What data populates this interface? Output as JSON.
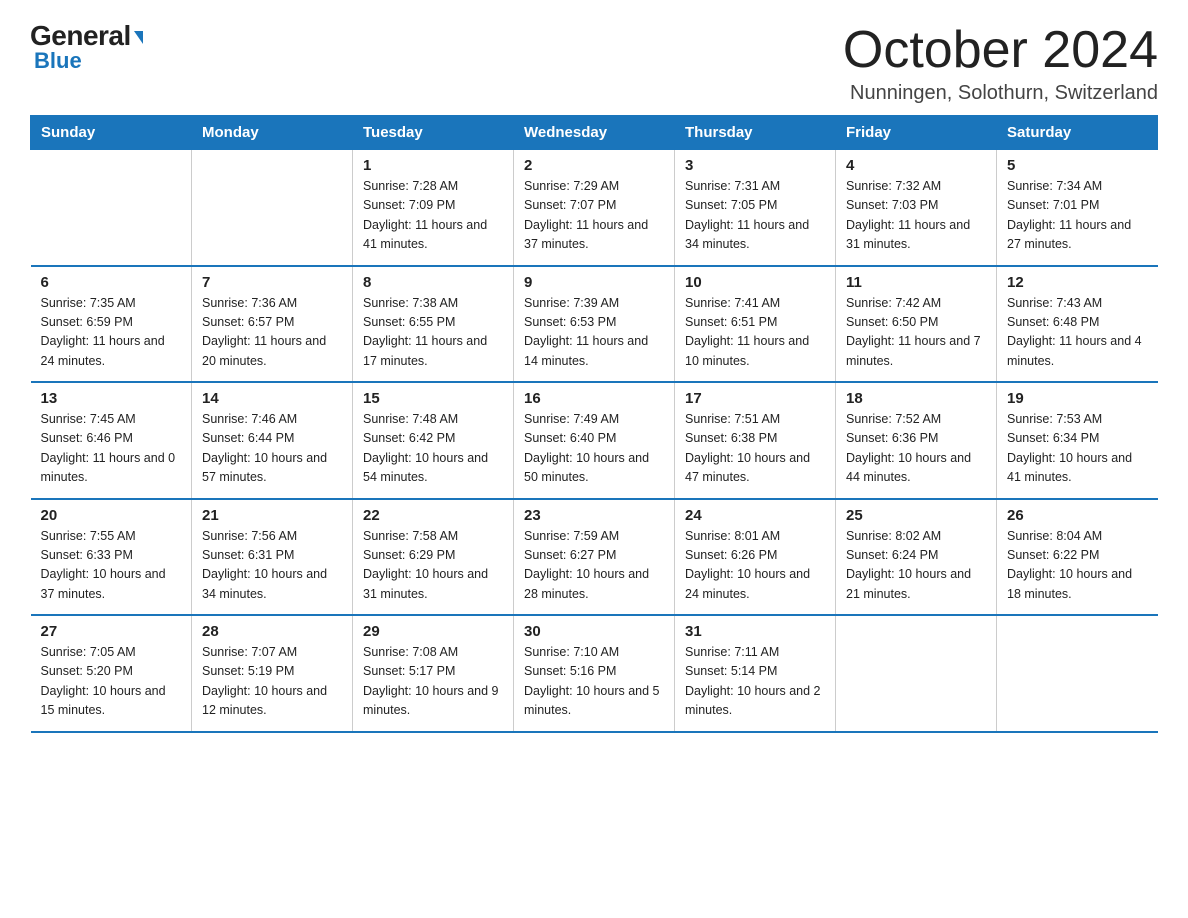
{
  "logo": {
    "general": "General",
    "triangle": "▶",
    "blue": "Blue"
  },
  "title": {
    "month_year": "October 2024",
    "location": "Nunningen, Solothurn, Switzerland"
  },
  "headers": [
    "Sunday",
    "Monday",
    "Tuesday",
    "Wednesday",
    "Thursday",
    "Friday",
    "Saturday"
  ],
  "weeks": [
    [
      {
        "day": "",
        "sunrise": "",
        "sunset": "",
        "daylight": ""
      },
      {
        "day": "",
        "sunrise": "",
        "sunset": "",
        "daylight": ""
      },
      {
        "day": "1",
        "sunrise": "Sunrise: 7:28 AM",
        "sunset": "Sunset: 7:09 PM",
        "daylight": "Daylight: 11 hours and 41 minutes."
      },
      {
        "day": "2",
        "sunrise": "Sunrise: 7:29 AM",
        "sunset": "Sunset: 7:07 PM",
        "daylight": "Daylight: 11 hours and 37 minutes."
      },
      {
        "day": "3",
        "sunrise": "Sunrise: 7:31 AM",
        "sunset": "Sunset: 7:05 PM",
        "daylight": "Daylight: 11 hours and 34 minutes."
      },
      {
        "day": "4",
        "sunrise": "Sunrise: 7:32 AM",
        "sunset": "Sunset: 7:03 PM",
        "daylight": "Daylight: 11 hours and 31 minutes."
      },
      {
        "day": "5",
        "sunrise": "Sunrise: 7:34 AM",
        "sunset": "Sunset: 7:01 PM",
        "daylight": "Daylight: 11 hours and 27 minutes."
      }
    ],
    [
      {
        "day": "6",
        "sunrise": "Sunrise: 7:35 AM",
        "sunset": "Sunset: 6:59 PM",
        "daylight": "Daylight: 11 hours and 24 minutes."
      },
      {
        "day": "7",
        "sunrise": "Sunrise: 7:36 AM",
        "sunset": "Sunset: 6:57 PM",
        "daylight": "Daylight: 11 hours and 20 minutes."
      },
      {
        "day": "8",
        "sunrise": "Sunrise: 7:38 AM",
        "sunset": "Sunset: 6:55 PM",
        "daylight": "Daylight: 11 hours and 17 minutes."
      },
      {
        "day": "9",
        "sunrise": "Sunrise: 7:39 AM",
        "sunset": "Sunset: 6:53 PM",
        "daylight": "Daylight: 11 hours and 14 minutes."
      },
      {
        "day": "10",
        "sunrise": "Sunrise: 7:41 AM",
        "sunset": "Sunset: 6:51 PM",
        "daylight": "Daylight: 11 hours and 10 minutes."
      },
      {
        "day": "11",
        "sunrise": "Sunrise: 7:42 AM",
        "sunset": "Sunset: 6:50 PM",
        "daylight": "Daylight: 11 hours and 7 minutes."
      },
      {
        "day": "12",
        "sunrise": "Sunrise: 7:43 AM",
        "sunset": "Sunset: 6:48 PM",
        "daylight": "Daylight: 11 hours and 4 minutes."
      }
    ],
    [
      {
        "day": "13",
        "sunrise": "Sunrise: 7:45 AM",
        "sunset": "Sunset: 6:46 PM",
        "daylight": "Daylight: 11 hours and 0 minutes."
      },
      {
        "day": "14",
        "sunrise": "Sunrise: 7:46 AM",
        "sunset": "Sunset: 6:44 PM",
        "daylight": "Daylight: 10 hours and 57 minutes."
      },
      {
        "day": "15",
        "sunrise": "Sunrise: 7:48 AM",
        "sunset": "Sunset: 6:42 PM",
        "daylight": "Daylight: 10 hours and 54 minutes."
      },
      {
        "day": "16",
        "sunrise": "Sunrise: 7:49 AM",
        "sunset": "Sunset: 6:40 PM",
        "daylight": "Daylight: 10 hours and 50 minutes."
      },
      {
        "day": "17",
        "sunrise": "Sunrise: 7:51 AM",
        "sunset": "Sunset: 6:38 PM",
        "daylight": "Daylight: 10 hours and 47 minutes."
      },
      {
        "day": "18",
        "sunrise": "Sunrise: 7:52 AM",
        "sunset": "Sunset: 6:36 PM",
        "daylight": "Daylight: 10 hours and 44 minutes."
      },
      {
        "day": "19",
        "sunrise": "Sunrise: 7:53 AM",
        "sunset": "Sunset: 6:34 PM",
        "daylight": "Daylight: 10 hours and 41 minutes."
      }
    ],
    [
      {
        "day": "20",
        "sunrise": "Sunrise: 7:55 AM",
        "sunset": "Sunset: 6:33 PM",
        "daylight": "Daylight: 10 hours and 37 minutes."
      },
      {
        "day": "21",
        "sunrise": "Sunrise: 7:56 AM",
        "sunset": "Sunset: 6:31 PM",
        "daylight": "Daylight: 10 hours and 34 minutes."
      },
      {
        "day": "22",
        "sunrise": "Sunrise: 7:58 AM",
        "sunset": "Sunset: 6:29 PM",
        "daylight": "Daylight: 10 hours and 31 minutes."
      },
      {
        "day": "23",
        "sunrise": "Sunrise: 7:59 AM",
        "sunset": "Sunset: 6:27 PM",
        "daylight": "Daylight: 10 hours and 28 minutes."
      },
      {
        "day": "24",
        "sunrise": "Sunrise: 8:01 AM",
        "sunset": "Sunset: 6:26 PM",
        "daylight": "Daylight: 10 hours and 24 minutes."
      },
      {
        "day": "25",
        "sunrise": "Sunrise: 8:02 AM",
        "sunset": "Sunset: 6:24 PM",
        "daylight": "Daylight: 10 hours and 21 minutes."
      },
      {
        "day": "26",
        "sunrise": "Sunrise: 8:04 AM",
        "sunset": "Sunset: 6:22 PM",
        "daylight": "Daylight: 10 hours and 18 minutes."
      }
    ],
    [
      {
        "day": "27",
        "sunrise": "Sunrise: 7:05 AM",
        "sunset": "Sunset: 5:20 PM",
        "daylight": "Daylight: 10 hours and 15 minutes."
      },
      {
        "day": "28",
        "sunrise": "Sunrise: 7:07 AM",
        "sunset": "Sunset: 5:19 PM",
        "daylight": "Daylight: 10 hours and 12 minutes."
      },
      {
        "day": "29",
        "sunrise": "Sunrise: 7:08 AM",
        "sunset": "Sunset: 5:17 PM",
        "daylight": "Daylight: 10 hours and 9 minutes."
      },
      {
        "day": "30",
        "sunrise": "Sunrise: 7:10 AM",
        "sunset": "Sunset: 5:16 PM",
        "daylight": "Daylight: 10 hours and 5 minutes."
      },
      {
        "day": "31",
        "sunrise": "Sunrise: 7:11 AM",
        "sunset": "Sunset: 5:14 PM",
        "daylight": "Daylight: 10 hours and 2 minutes."
      },
      {
        "day": "",
        "sunrise": "",
        "sunset": "",
        "daylight": ""
      },
      {
        "day": "",
        "sunrise": "",
        "sunset": "",
        "daylight": ""
      }
    ]
  ]
}
